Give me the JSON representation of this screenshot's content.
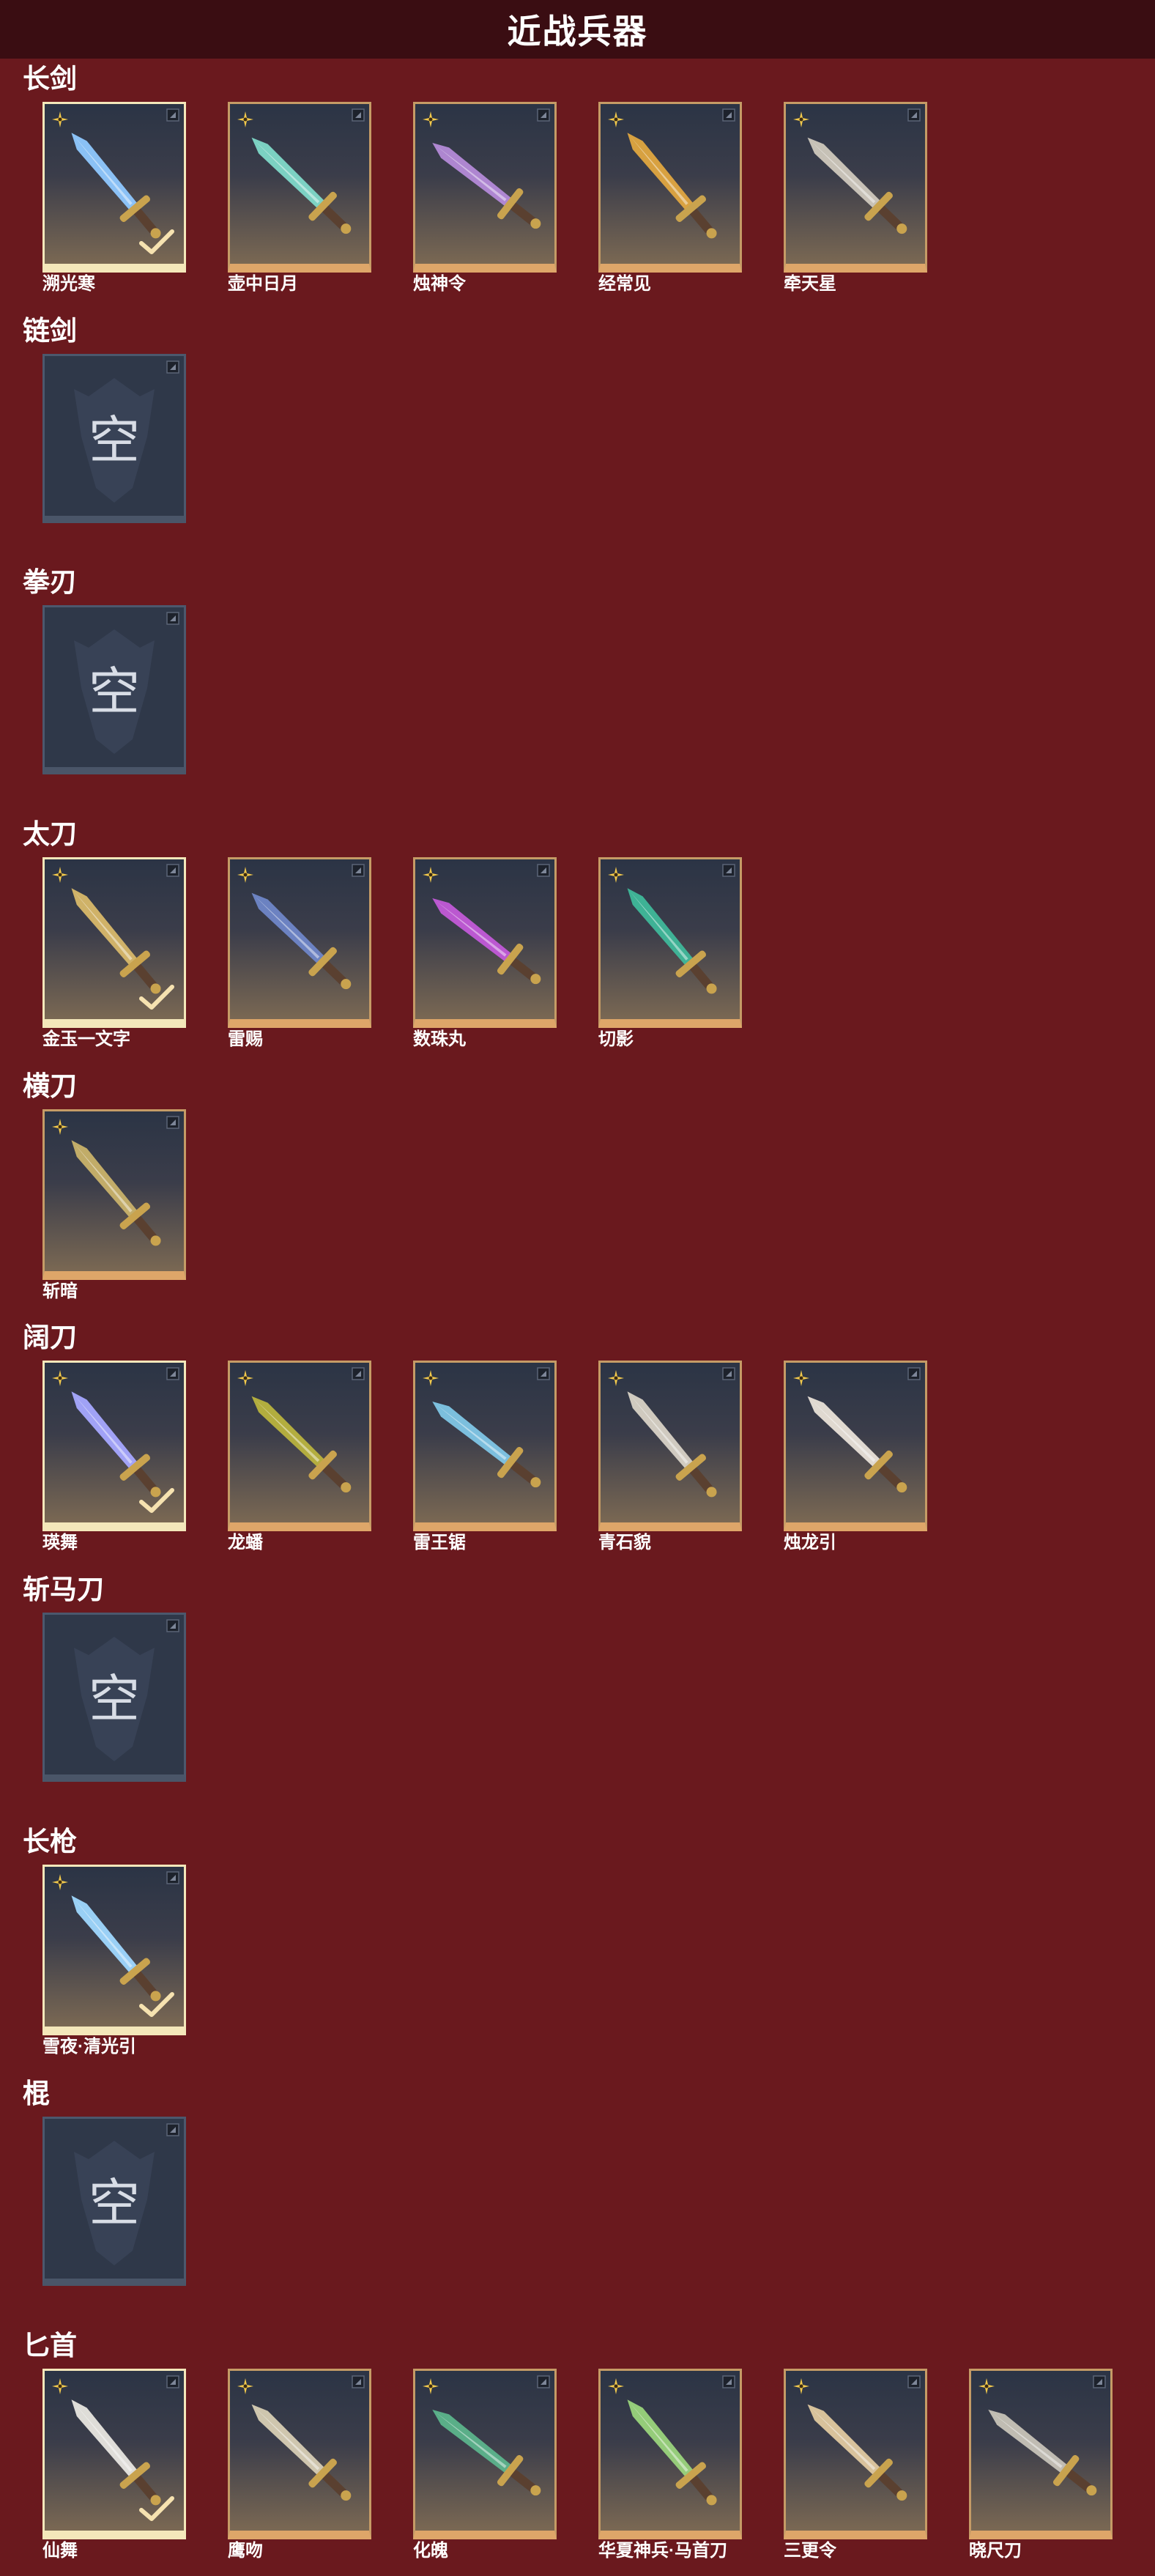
{
  "page_title": "近战兵器",
  "empty_label": "空",
  "sections": [
    {
      "title": "长剑",
      "items": [
        {
          "name": "溯光寒",
          "selected": true,
          "color": "#8fc8ff"
        },
        {
          "name": "壶中日月",
          "selected": false,
          "color": "#7fd9c9"
        },
        {
          "name": "烛神令",
          "selected": false,
          "color": "#b48ad8"
        },
        {
          "name": "经常见",
          "selected": false,
          "color": "#e0a640"
        },
        {
          "name": "牵天星",
          "selected": false,
          "color": "#cfc8bd"
        }
      ]
    },
    {
      "title": "链剑",
      "items": []
    },
    {
      "title": "拳刃",
      "items": []
    },
    {
      "title": "太刀",
      "items": [
        {
          "name": "金玉一文字",
          "selected": true,
          "color": "#d8b86a"
        },
        {
          "name": "雷赐",
          "selected": false,
          "color": "#6f86c8"
        },
        {
          "name": "数珠丸",
          "selected": false,
          "color": "#c25ad8"
        },
        {
          "name": "切影",
          "selected": false,
          "color": "#3fb89a"
        }
      ]
    },
    {
      "title": "横刀",
      "items": [
        {
          "name": "斩暗",
          "selected": false,
          "color": "#c9b26a"
        }
      ]
    },
    {
      "title": "阔刀",
      "items": [
        {
          "name": "瑛舞",
          "selected": true,
          "color": "#a7a8ff"
        },
        {
          "name": "龙蟠",
          "selected": false,
          "color": "#b9b33e"
        },
        {
          "name": "雷王锯",
          "selected": false,
          "color": "#7fc6e6"
        },
        {
          "name": "青石貌",
          "selected": false,
          "color": "#d8d2c6"
        },
        {
          "name": "烛龙引",
          "selected": false,
          "color": "#e9e2d8"
        }
      ]
    },
    {
      "title": "斩马刀",
      "items": []
    },
    {
      "title": "长枪",
      "items": [
        {
          "name": "雪夜·清光引",
          "selected": true,
          "color": "#9fd8ff"
        }
      ]
    },
    {
      "title": "棍",
      "items": []
    },
    {
      "title": "匕首",
      "items": [
        {
          "name": "仙舞",
          "selected": true,
          "color": "#e8e6e0"
        },
        {
          "name": "鹰吻",
          "selected": false,
          "color": "#d7cdb4"
        },
        {
          "name": "化魄",
          "selected": false,
          "color": "#5cb48c"
        },
        {
          "name": "华夏神兵·马首刀",
          "selected": false,
          "color": "#9ad47c"
        },
        {
          "name": "三更令",
          "selected": false,
          "color": "#e0c9a0"
        },
        {
          "name": "晓尺刀",
          "selected": false,
          "color": "#c7c3b8"
        }
      ]
    }
  ]
}
